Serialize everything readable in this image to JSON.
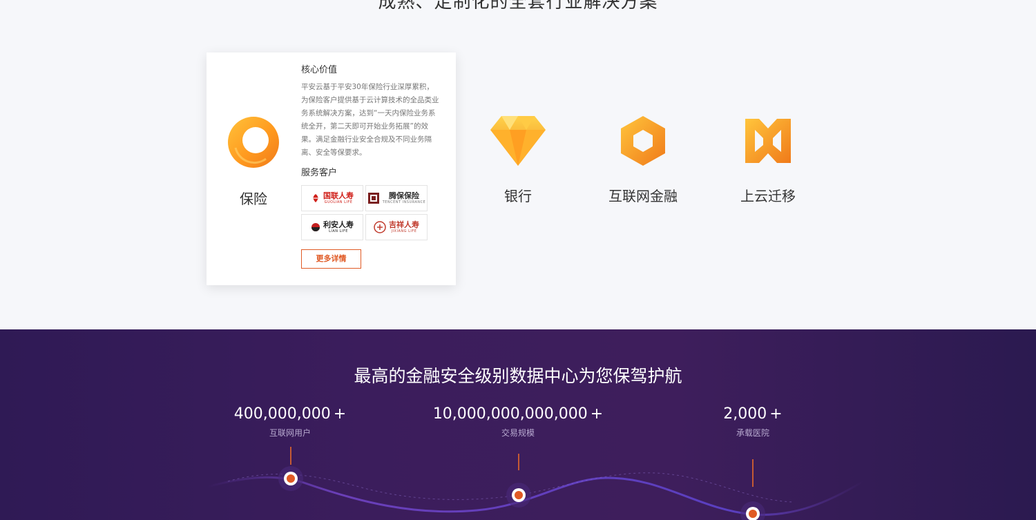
{
  "section": {
    "title": "成熟、定制化的全套行业解决方案"
  },
  "insurance_card": {
    "label": "保险",
    "core_title": "核心价值",
    "core_desc": "平安云基于平安30年保险行业深厚累积，为保险客户提供基于云计算技术的全品类业务系统解决方案，达到“一天内保险业务系统全开，第二天即可开始业务拓展”的效果。满足金融行业安全合规及不同业务隔离、安全等保要求。",
    "service_title": "服务客户",
    "logos": [
      {
        "name": "国联人寿",
        "sub": "GUOLIAN LIFE",
        "badge": "GLR",
        "color": "#d0201a"
      },
      {
        "name": "腾保保险",
        "sub": "TENCENT INSURANCE",
        "color": "#333333"
      },
      {
        "name": "利安人寿",
        "sub": "LIAN  LIFE",
        "color": "#222222"
      },
      {
        "name": "吉祥人寿",
        "sub": "JIXIANG LIFE",
        "color": "#c0392b"
      }
    ],
    "more_button": "更多详情"
  },
  "industries": [
    {
      "label": "银行",
      "icon": "diamond-icon"
    },
    {
      "label": "互联网金融",
      "icon": "hexagon-ring-icon"
    },
    {
      "label": "上云迁移",
      "icon": "migration-icon"
    }
  ],
  "security": {
    "title": "最高的金融安全级别数据中心为您保驾护航",
    "stats": [
      {
        "value": "400,000,000",
        "plus": "+",
        "label": "互联网用户"
      },
      {
        "value": "10,000,000,000,000",
        "plus": "+",
        "label": "交易规模"
      },
      {
        "value": "2,000",
        "plus": "+",
        "label": "承载医院"
      }
    ]
  },
  "colors": {
    "accent": "#e05a25",
    "orange_light": "#ffc23a",
    "orange_dark": "#f07a1a",
    "bottom_bg": "#3b1d5c"
  }
}
